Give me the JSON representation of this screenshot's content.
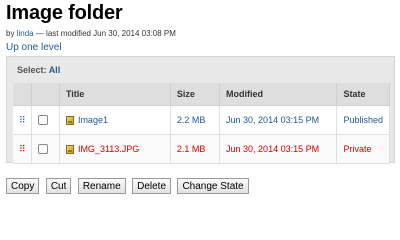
{
  "page": {
    "title": "Image folder",
    "by_prefix": "by",
    "author": "linda",
    "last_modified": "— last modified Jun 30, 2014 03:08 PM",
    "up_link": "Up one level"
  },
  "listing": {
    "select_label": "Select:",
    "select_all": "All",
    "columns": [
      "Title",
      "Size",
      "Modified",
      "State"
    ],
    "rows": [
      {
        "title": "Image1",
        "size": "2.2 MB",
        "modified": "Jun 30, 2014 03:15 PM",
        "state": "Published",
        "state_color": "#205c90"
      },
      {
        "title": "IMG_3113.JPG",
        "size": "2.1 MB",
        "modified": "Jun 30, 2014 03:15 PM",
        "state": "Private",
        "state_color": "#d40000"
      }
    ]
  },
  "buttons": {
    "copy": "Copy",
    "cut": "Cut",
    "rename": "Rename",
    "delete": "Delete",
    "change_state": "Change State"
  },
  "icons": {
    "drag": "drag-handle-icon",
    "file": "image-file-icon"
  }
}
